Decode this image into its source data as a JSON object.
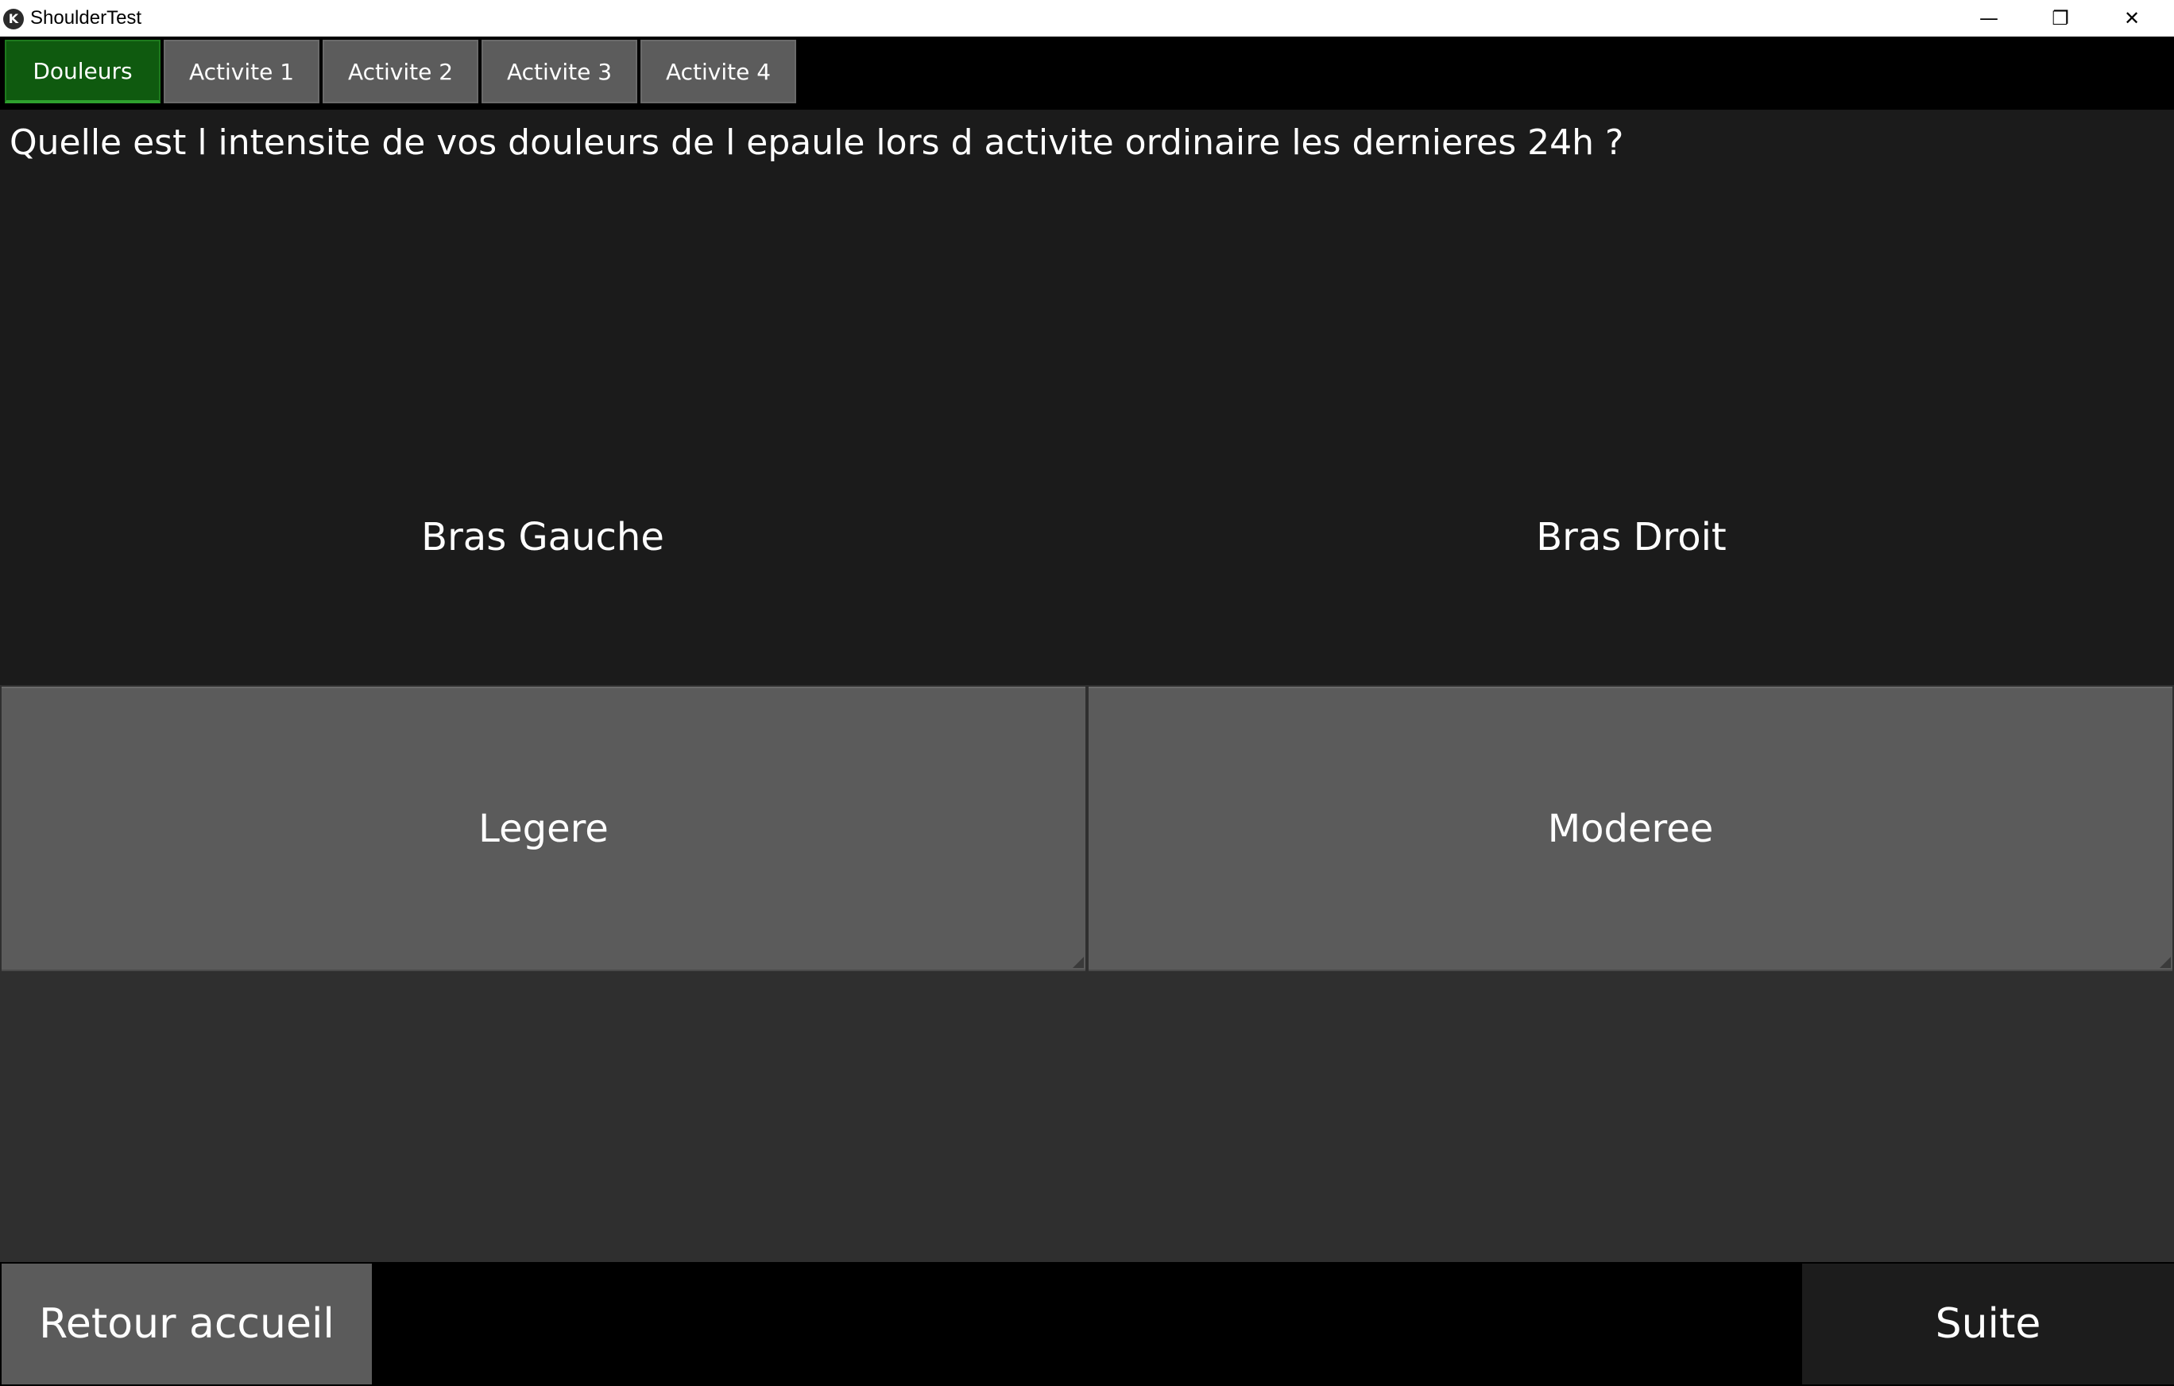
{
  "window": {
    "title": "ShoulderTest",
    "icon": "kivy-app-icon",
    "controls": {
      "minimize": "—",
      "maximize": "❐",
      "close": "✕"
    }
  },
  "tabs": [
    {
      "label": "Douleurs",
      "active": true
    },
    {
      "label": "Activite 1",
      "active": false
    },
    {
      "label": "Activite 2",
      "active": false
    },
    {
      "label": "Activite 3",
      "active": false
    },
    {
      "label": "Activite 4",
      "active": false
    }
  ],
  "question": {
    "text": "Quelle est l intensite de vos douleurs de l epaule lors d activite ordinaire les dernieres 24h ?",
    "left_arm": "Bras Gauche",
    "right_arm": "Bras Droit"
  },
  "answers": {
    "left": "Legere",
    "right": "Moderee"
  },
  "footer": {
    "back_label": "Retour accueil",
    "next_label": "Suite"
  },
  "colors": {
    "active_tab": "#0f5a0f",
    "button": "#5b5b5b",
    "background": "#1b1b1b"
  }
}
